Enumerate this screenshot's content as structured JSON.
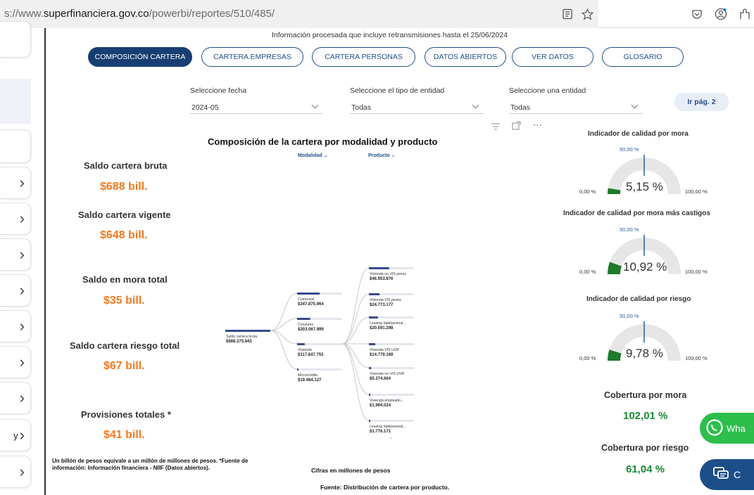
{
  "browser": {
    "url_prefix": "s://www.",
    "url_domain": "superfinanciera.gov.co",
    "url_path": "/powerbi/reportes/510/485/"
  },
  "sidebar": {
    "stray_label": "y"
  },
  "report": {
    "info_line": "Información procesada que incluye retransmisiones hasta el 25/06/2024",
    "tabs": [
      {
        "label": "COMPOSICIÓN CARTERA",
        "active": true
      },
      {
        "label": "CARTERA EMPRESAS"
      },
      {
        "label": "CARTERA PERSONAS"
      },
      {
        "label": "DATOS ABIERTOS"
      },
      {
        "label": "VER DATOS"
      },
      {
        "label": "GLOSARIO"
      }
    ],
    "filters": [
      {
        "label": "Seleccione fecha",
        "value": "2024-05"
      },
      {
        "label": "Seleccione el tipo de entidad",
        "value": "Todas"
      },
      {
        "label": "Seleccione una entidad",
        "value": "Todas"
      }
    ],
    "ir_pag": "Ir pág. 2",
    "kpis": [
      {
        "title": "Saldo cartera bruta",
        "value": "$688 bill."
      },
      {
        "title": "Saldo cartera vigente",
        "value": "$648 bill."
      },
      {
        "title": "Saldo en mora total",
        "value": "$35 bill."
      },
      {
        "title": "Saldo cartera riesgo total",
        "value": "$67 bill."
      },
      {
        "title": "Provisiones totales *",
        "value": "$41 bill."
      }
    ],
    "footnote": "Un billón de pesos equivale a un millón de millones de pesos. *Fuente de información: Información financiera - NIIF (Datos abiertos).",
    "cifras_note": "Cifras en millones de pesos",
    "fuente_note": "Fuente: Distribución de cartera por producto.",
    "coverage": [
      {
        "title": "Cobertura por mora",
        "value": "102,01 %"
      },
      {
        "title": "Cobertura por riesgo",
        "value": "61,04 %"
      }
    ],
    "whatsapp_label": "Wha",
    "chat_label": "C"
  },
  "gauges": [
    {
      "title": "Indicador de calidad por mora",
      "value": "5,15 %",
      "fraction": 0.0515,
      "min": "0,00 %",
      "max": "100,00 %",
      "target": "50,00 %"
    },
    {
      "title": "Indicador de calidad por mora más castigos",
      "value": "10,92 %",
      "fraction": 0.1092,
      "min": "0,00 %",
      "max": "100,00 %",
      "target": "50,00 %"
    },
    {
      "title": "Indicador de calidad por riesgo",
      "value": "9,78 %",
      "fraction": 0.0978,
      "min": "0,00 %",
      "max": "100,00 %",
      "target": "50,00 %"
    }
  ],
  "chart_data": {
    "type": "decomposition-tree",
    "title": "Composición de la cartera por modalidad y producto",
    "headers": [
      "Modalidad",
      "Producto"
    ],
    "root": {
      "label": "Saldo cartera bruta",
      "value": 688375843
    },
    "modalidad": [
      {
        "label": "Comercial",
        "value": 347875964
      },
      {
        "label": "Consumo",
        "value": 203067999
      },
      {
        "label": "Vivienda",
        "value": 117847753,
        "expanded": true
      },
      {
        "label": "Microcrédito",
        "value": 19484127
      }
    ],
    "producto": [
      {
        "label": "Vivienda no VIS pesos",
        "value": 46953876
      },
      {
        "label": "Vivienda VIS pesos",
        "value": 24773177
      },
      {
        "label": "Leasing habitacional...",
        "value": 20591298
      },
      {
        "label": "Vivienda VIS UVR",
        "value": 14779169
      },
      {
        "label": "Vivienda no VIS UVR",
        "value": 5374664
      },
      {
        "label": "Vivienda empleado...",
        "value": 1994024
      },
      {
        "label": "Leasing habitacional...",
        "value": 1776171
      }
    ]
  },
  "colors": {
    "accent": "#1f4e8c",
    "kpi_value": "#f47920",
    "gauge_fill": "#1e7a2c",
    "coverage_value": "#1a8a34"
  }
}
